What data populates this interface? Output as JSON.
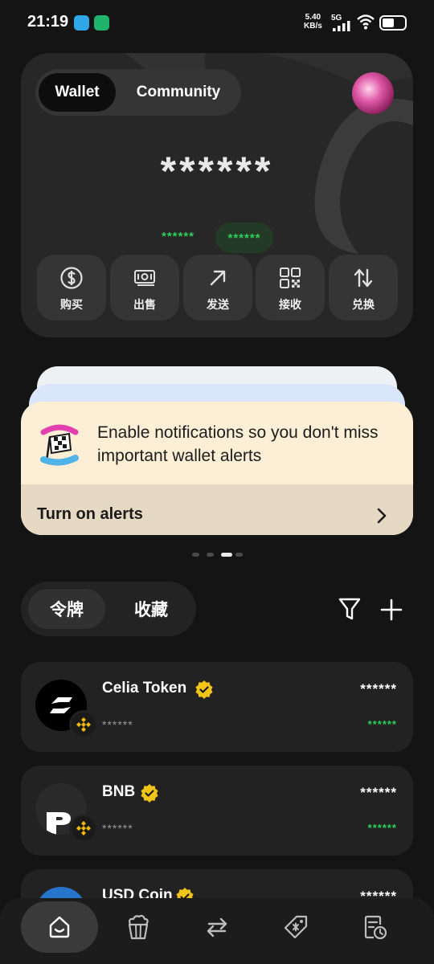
{
  "status_bar": {
    "time": "21:19",
    "net_speed_value": "5.40",
    "net_speed_unit": "KB/s",
    "network": "5G"
  },
  "header": {
    "tabs": [
      "Wallet",
      "Community"
    ],
    "active_tab": "Wallet"
  },
  "wallet": {
    "balance": "******",
    "change_amount": "******",
    "change_percent": "******",
    "actions": [
      {
        "label": "购买",
        "icon": "dollar-circle-icon"
      },
      {
        "label": "出售",
        "icon": "cash-icon"
      },
      {
        "label": "发送",
        "icon": "arrow-up-right-icon"
      },
      {
        "label": "接收",
        "icon": "qr-code-icon"
      },
      {
        "label": "兑换",
        "icon": "swap-arrows-icon"
      }
    ]
  },
  "notification": {
    "message": "Enable notifications so you don't miss important wallet alerts",
    "cta": "Turn on alerts",
    "page_count": 4,
    "active_page": 3
  },
  "token_list": {
    "tabs": [
      "令牌",
      "收藏"
    ],
    "active_tab": "令牌",
    "tokens": [
      {
        "name": "Celia Token",
        "sub": "******",
        "amount": "******",
        "change": "******",
        "verified": true
      },
      {
        "name": "BNB",
        "sub": "******",
        "amount": "******",
        "change": "******",
        "verified": true
      },
      {
        "name": "USD Coin",
        "sub": "",
        "amount": "******",
        "change": "",
        "verified": true
      }
    ]
  },
  "bottom_nav": {
    "items": [
      "home-icon",
      "popcorn-icon",
      "swap-icon",
      "rewards-tag-icon",
      "history-icon"
    ],
    "active": "home-icon"
  },
  "colors": {
    "background": "#141414",
    "card": "#272727",
    "positive": "#2fd05a",
    "verified": "#f0c419",
    "bnb": "#f0b90b",
    "notification_bg": "#fdeed6"
  }
}
